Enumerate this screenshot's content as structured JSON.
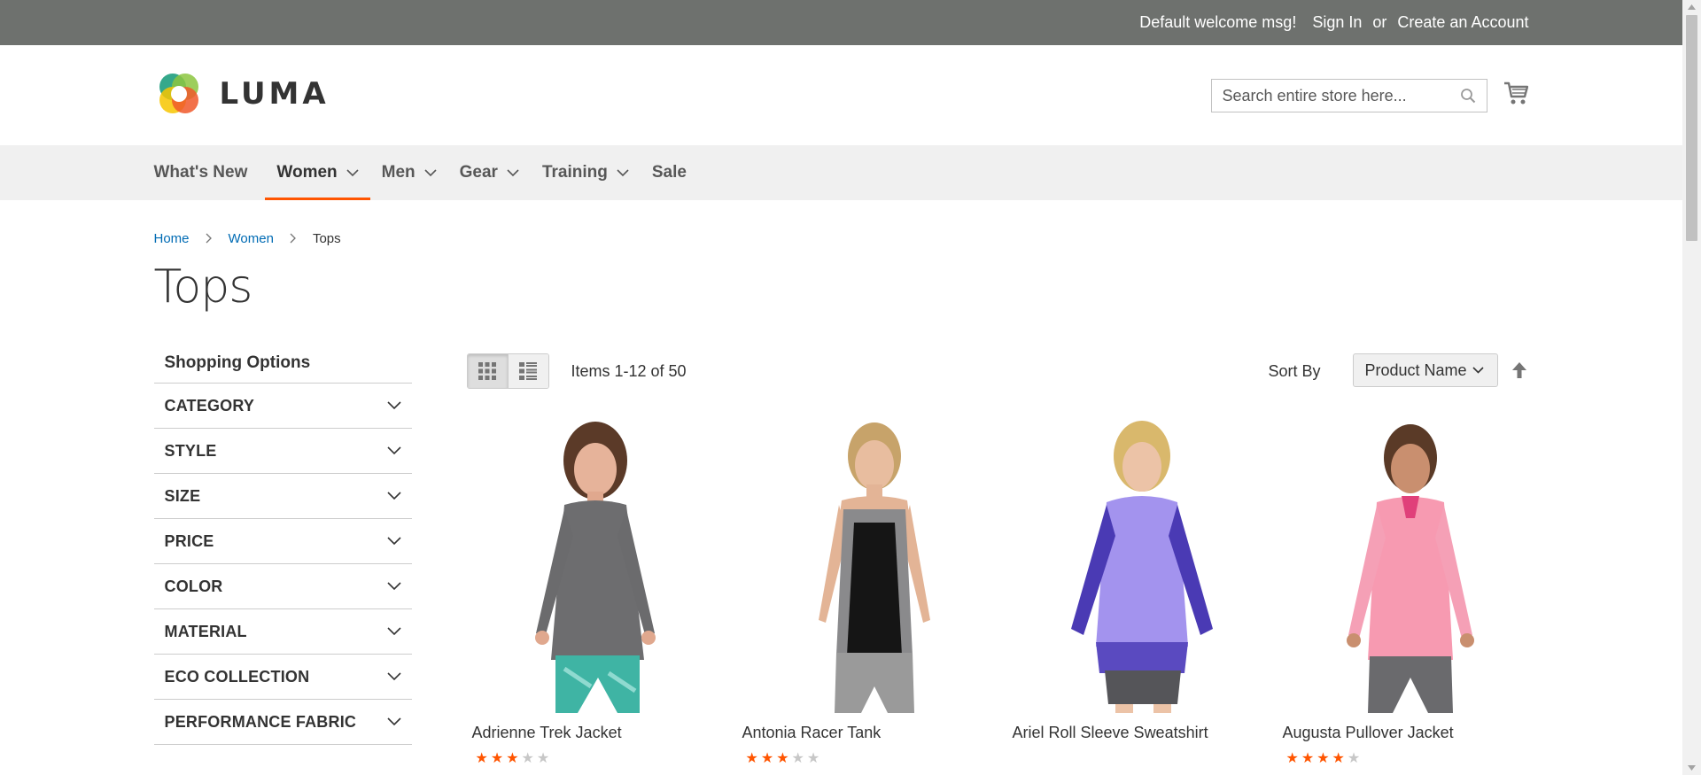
{
  "panel": {
    "welcome": "Default welcome msg!",
    "sign_in": "Sign In",
    "or": "or",
    "create_account": "Create an Account"
  },
  "logo": {
    "word": "LUMA"
  },
  "search": {
    "placeholder": "Search entire store here..."
  },
  "nav": {
    "items": [
      {
        "label": "What's New"
      },
      {
        "label": "Women"
      },
      {
        "label": "Men"
      },
      {
        "label": "Gear"
      },
      {
        "label": "Training"
      },
      {
        "label": "Sale"
      }
    ]
  },
  "breadcrumbs": {
    "home": "Home",
    "women": "Women",
    "current": "Tops"
  },
  "page": {
    "title": "Tops"
  },
  "sidebar": {
    "title": "Shopping Options",
    "filters": [
      "CATEGORY",
      "STYLE",
      "SIZE",
      "PRICE",
      "COLOR",
      "MATERIAL",
      "ECO COLLECTION",
      "PERFORMANCE FABRIC"
    ]
  },
  "toolbar": {
    "amount": "Items 1-12 of 50",
    "sort_label": "Sort By",
    "sort_value": "Product Name"
  },
  "products": [
    {
      "name": "Adrienne Trek Jacket",
      "rating_stars": 3
    },
    {
      "name": "Antonia Racer Tank",
      "rating_stars": 3
    },
    {
      "name": "Ariel Roll Sleeve Sweatshirt",
      "rating_stars": 0
    },
    {
      "name": "Augusta Pullover Jacket",
      "rating_stars": 4
    }
  ],
  "colors": {
    "panel": "#6e716e",
    "nav_bg": "#f0f0f0",
    "accent": "#ff5501",
    "link": "#006bb4"
  },
  "icons": {
    "search": "search-icon",
    "cart": "cart-icon",
    "grid": "grid-icon",
    "list": "list-icon",
    "sort_direction": "arrow-up-icon"
  }
}
